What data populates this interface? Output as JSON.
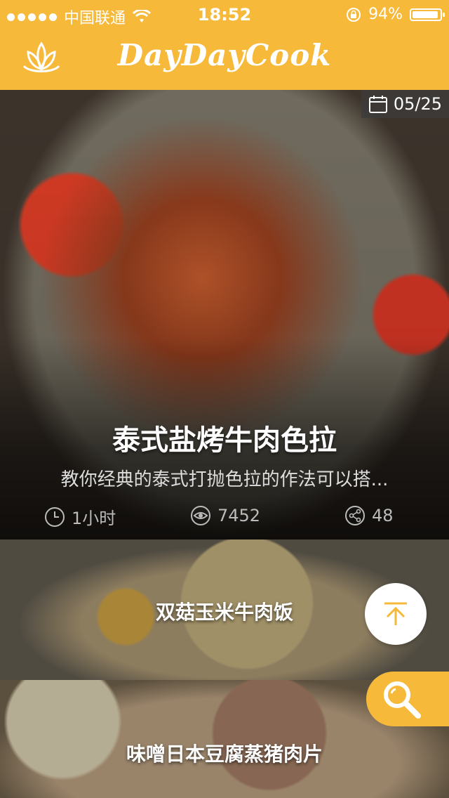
{
  "status_bar": {
    "carrier": "中国联通",
    "time": "18:52",
    "battery": "94%",
    "battery_level": 0.94,
    "icons": [
      "signal-dots-icon",
      "wifi-icon",
      "rotation-lock-icon",
      "battery-icon"
    ]
  },
  "nav": {
    "title": "DayDayCook",
    "logo_icon": "lotus-logo-icon"
  },
  "featured": {
    "date": "05/25",
    "title": "泰式盐烤牛肉色拉",
    "subtitle": "教你经典的泰式打抛色拉的作法可以搭...",
    "time": "1小时",
    "views": "7452",
    "shares": "48"
  },
  "recipes": [
    {
      "title": "双菇玉米牛肉饭"
    },
    {
      "title": "味噌日本豆腐蒸猪肉片"
    }
  ],
  "colors": {
    "brand_yellow": "#f6b93a"
  }
}
